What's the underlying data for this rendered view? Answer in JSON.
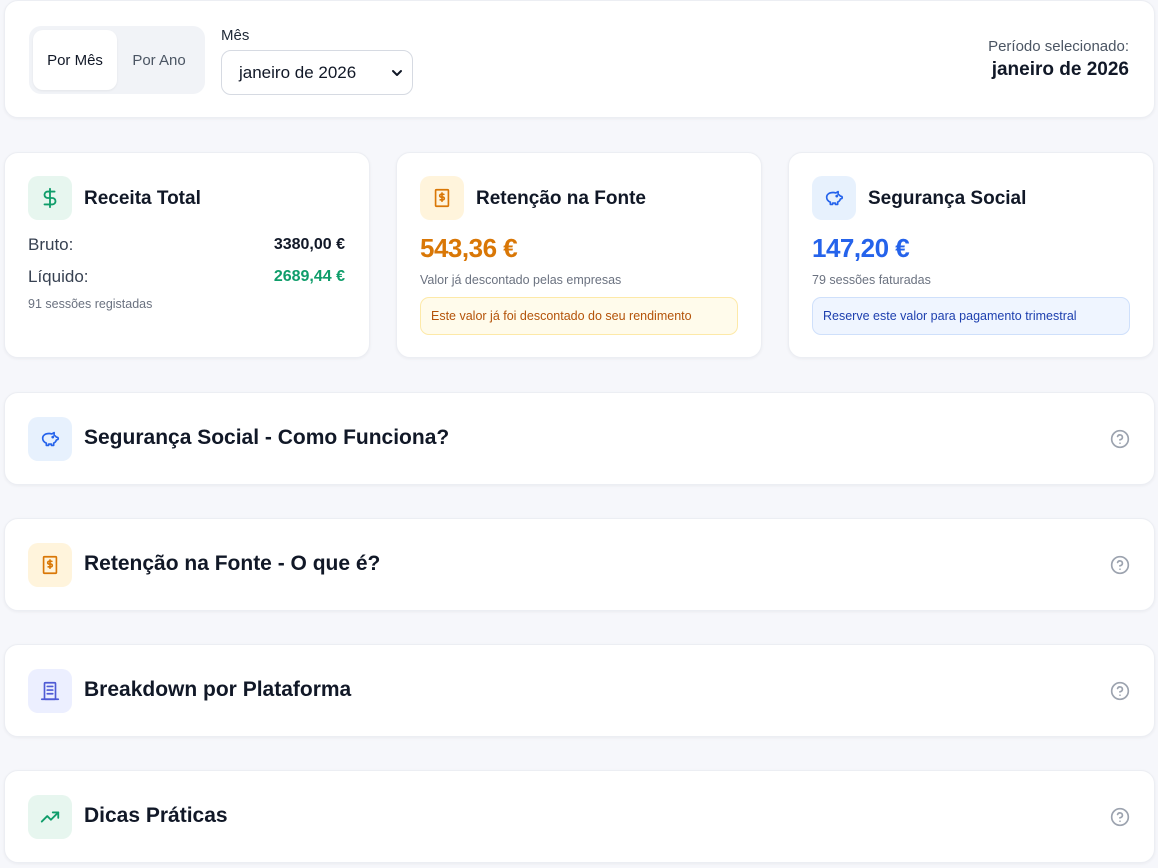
{
  "toggle": {
    "by_month": "Por Mês",
    "by_year": "Por Ano",
    "active": "by_month"
  },
  "month": {
    "label": "Mês",
    "selected": "janeiro de 2026"
  },
  "period": {
    "label": "Período selecionado:",
    "value": "janeiro de 2026"
  },
  "cards": {
    "receita": {
      "icon": "dollar-icon",
      "title": "Receita Total",
      "gross_label": "Bruto:",
      "gross_value": "3380,00 €",
      "net_label": "Líquido:",
      "net_value": "2689,44 €",
      "note": "91 sessões registadas"
    },
    "retencao": {
      "icon": "receipt-icon",
      "title": "Retenção na Fonte",
      "amount": "543,36 €",
      "subtitle": "Valor já descontado pelas empresas",
      "pill": "Este valor já foi descontado do seu rendimento"
    },
    "seguranca": {
      "icon": "piggy-bank-icon",
      "title": "Segurança Social",
      "amount": "147,20 €",
      "subtitle": "79 sessões faturadas",
      "pill": "Reserve este valor para pagamento trimestral"
    }
  },
  "accordions": [
    {
      "icon": "piggy-bank-icon",
      "title": "Segurança Social - Como Funciona?"
    },
    {
      "icon": "receipt-icon",
      "title": "Retenção na Fonte - O que é?"
    },
    {
      "icon": "building-icon",
      "title": "Breakdown por Plataforma"
    },
    {
      "icon": "trending-up-icon",
      "title": "Dicas Práticas"
    }
  ],
  "colors": {
    "green": "#0f9d6a",
    "amber": "#d97706",
    "blue": "#2563eb",
    "indigo": "#4f5bd5",
    "help_gray": "#9ca3af"
  }
}
